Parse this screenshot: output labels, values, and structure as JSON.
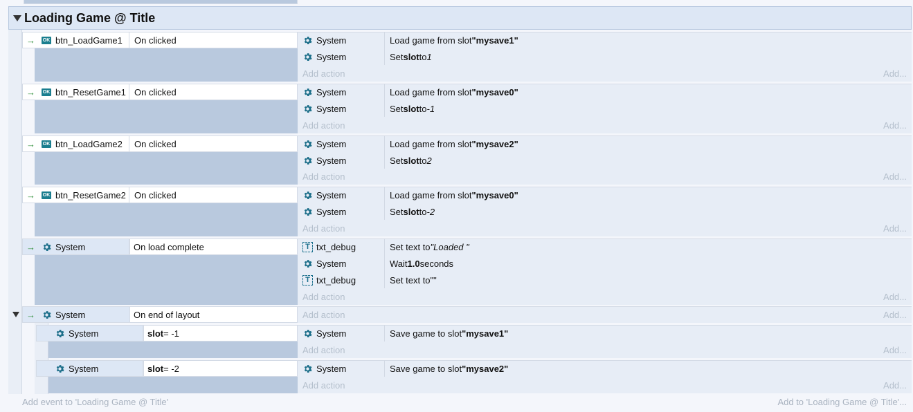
{
  "group": {
    "title": "Loading Game @ Title"
  },
  "add_action_label": "Add action",
  "add_right_label": "Add...",
  "events": [
    {
      "object": "btn_LoadGame1",
      "condition": "On clicked",
      "actions": [
        {
          "object": "System",
          "pre": "Load game from slot ",
          "b": "\"mysave1\"",
          "i": "",
          "post": ""
        },
        {
          "object": "System",
          "pre": "Set ",
          "b": "slot",
          "mid": " to ",
          "i": "1",
          "post": ""
        }
      ]
    },
    {
      "object": "btn_ResetGame1",
      "condition": "On clicked",
      "actions": [
        {
          "object": "System",
          "pre": "Load game from slot ",
          "b": "\"mysave0\"",
          "i": "",
          "post": ""
        },
        {
          "object": "System",
          "pre": "Set ",
          "b": "slot",
          "mid": " to ",
          "i": "-1",
          "post": ""
        }
      ]
    },
    {
      "object": "btn_LoadGame2",
      "condition": "On clicked",
      "actions": [
        {
          "object": "System",
          "pre": "Load game from slot ",
          "b": "\"mysave2\"",
          "i": "",
          "post": ""
        },
        {
          "object": "System",
          "pre": "Set ",
          "b": "slot",
          "mid": " to ",
          "i": "2",
          "post": ""
        }
      ]
    },
    {
      "object": "btn_ResetGame2",
      "condition": "On clicked",
      "actions": [
        {
          "object": "System",
          "pre": "Load game from slot ",
          "b": "\"mysave0\"",
          "i": "",
          "post": ""
        },
        {
          "object": "System",
          "pre": "Set ",
          "b": "slot",
          "mid": " to ",
          "i": "-2",
          "post": ""
        }
      ]
    },
    {
      "object": "System",
      "condition": "On load complete",
      "actions": [
        {
          "object": "txt_debug",
          "pre": "Set text to ",
          "i": "\"Loaded \"",
          "post": ""
        },
        {
          "object": "System",
          "pre": "Wait ",
          "b": "1.0",
          "post": " seconds"
        },
        {
          "object": "txt_debug",
          "pre": "Set text to ",
          "post": "\"\""
        }
      ]
    },
    {
      "object": "System",
      "condition": "On end of layout",
      "subevents": [
        {
          "object": "System",
          "cond_b": "slot",
          "cond_post": " = -1",
          "action": {
            "object": "System",
            "pre": "Save game to slot ",
            "b": "\"mysave1\""
          }
        },
        {
          "object": "System",
          "cond_b": "slot",
          "cond_post": " = -2",
          "action": {
            "object": "System",
            "pre": "Save game to slot ",
            "b": "\"mysave2\""
          }
        }
      ]
    }
  ],
  "footer": {
    "add_event": "Add event to 'Loading Game @ Title'",
    "add_to": "Add to 'Loading Game @ Title'..."
  },
  "icons": {
    "ok": "OK",
    "text": "T",
    "gear_color": "#1d6f8a",
    "arrow": "→"
  }
}
